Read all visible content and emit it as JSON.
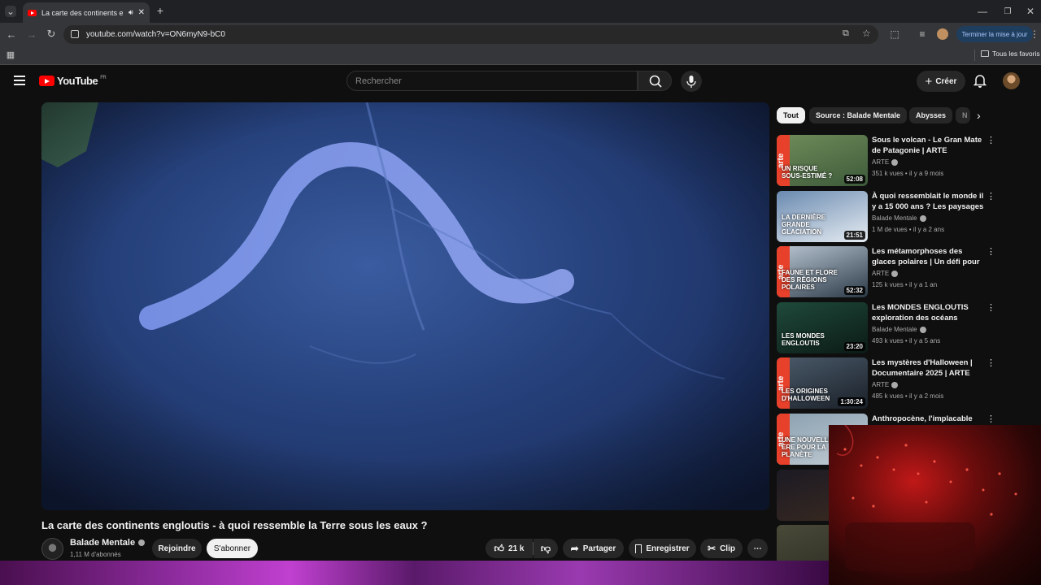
{
  "browser": {
    "tab_title": "La carte des continents eng",
    "url": "youtube.com/watch?v=ON6myN9-bC0",
    "update_button": "Terminer la mise à jour",
    "bookmarks_label": "Tous les favoris"
  },
  "header": {
    "logo_text": "YouTube",
    "region": "FR",
    "search_placeholder": "Rechercher",
    "create_label": "Créer"
  },
  "video": {
    "title": "La carte des continents engloutis - à quoi ressemble la Terre sous les eaux ?",
    "channel": "Balade Mentale",
    "subscribers": "1,11 M d'abonnés",
    "join_label": "Rejoindre",
    "subscribe_label": "S'abonner",
    "likes": "21 k",
    "share_label": "Partager",
    "save_label": "Enregistrer",
    "clip_label": "Clip"
  },
  "chips": [
    "Tout",
    "Source : Balade Mentale",
    "Abysses",
    "N"
  ],
  "recommendations": [
    {
      "title": "Sous le volcan - Le Gran Mate de Patagonie | ARTE",
      "channel": "ARTE",
      "views": "351 k vues",
      "age": "il y a 9 mois",
      "duration": "52:08",
      "thumb_text": "UN RISQUE\nSOUS-ESTIMÉ ?",
      "arte": true,
      "colors": [
        "#6f8c5a",
        "#3d5a3a"
      ]
    },
    {
      "title": "À quoi ressemblait le monde il y a 15 000 ans ? Les paysages ...",
      "channel": "Balade Mentale",
      "views": "1 M de vues",
      "age": "il y a 2 ans",
      "duration": "21:51",
      "thumb_text": "LA DERNIÈRE GRANDE\nGLACIATION",
      "arte": false,
      "colors": [
        "#6a8ab0",
        "#e6ecf2"
      ]
    },
    {
      "title": "Les métamorphoses des glaces polaires | Un défi pour les ...",
      "channel": "ARTE",
      "views": "125 k vues",
      "age": "il y a 1 an",
      "duration": "52:32",
      "thumb_text": "FAUNE ET FLORE\nDES RÉGIONS\nPOLAIRES",
      "arte": true,
      "colors": [
        "#b9c6d2",
        "#2c3a48"
      ]
    },
    {
      "title": "Les MONDES ENGLOUTIS exploration des océans",
      "channel": "Balade Mentale",
      "views": "493 k vues",
      "age": "il y a 5 ans",
      "duration": "23:20",
      "thumb_text": "LES MONDES\nENGLOUTIS",
      "arte": false,
      "colors": [
        "#1f4a3a",
        "#0b1a16"
      ]
    },
    {
      "title": "Les mystères d'Halloween | Documentaire 2025 | ARTE",
      "channel": "ARTE",
      "views": "485 k vues",
      "age": "il y a 2 mois",
      "duration": "1:30:24",
      "thumb_text": "LES ORIGINES\nD'HALLOWEEN",
      "arte": true,
      "colors": [
        "#4a5a6a",
        "#1a2028"
      ]
    },
    {
      "title": "Anthropocène, l'implacable",
      "channel": "",
      "views": "",
      "age": "",
      "duration": "",
      "thumb_text": "UNE NOUVELLE\nÈRE POUR LA\nPLANÈTE",
      "arte": true,
      "colors": [
        "#8aa0b0",
        "#c2ccd4"
      ]
    },
    {
      "title": "",
      "channel": "",
      "views": "",
      "age": "",
      "duration": "",
      "thumb_text": "",
      "arte": false,
      "colors": [
        "#1c1a24",
        "#3a2a20"
      ]
    },
    {
      "title": "",
      "channel": "",
      "views": "",
      "age": "",
      "duration": "",
      "thumb_text": "",
      "arte": false,
      "colors": [
        "#4a4a3a",
        "#2a2a20"
      ]
    }
  ],
  "colors": {
    "brand_red": "#ff0000",
    "arte_red": "#e8412b",
    "background": "#0f0f0f"
  }
}
